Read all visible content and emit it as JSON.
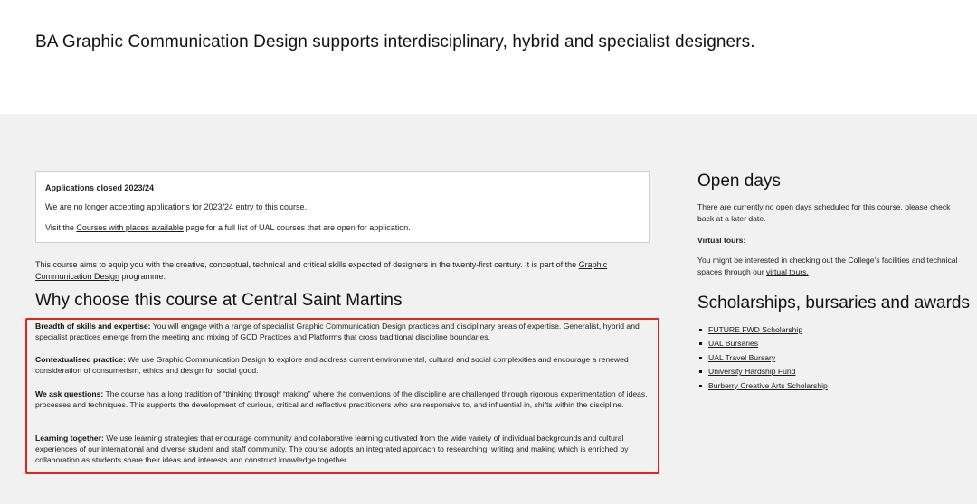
{
  "hero": {
    "title": "BA Graphic Communication Design supports interdisciplinary, hybrid and specialist designers."
  },
  "notice": {
    "title": "Applications closed 2023/24",
    "line1": "We are no longer accepting applications for 2023/24 entry to this course.",
    "line2_before": "Visit the ",
    "line2_link": "Courses with places available",
    "line2_after": " page for a full list of UAL courses that are open for application."
  },
  "intro": {
    "text": "This course aims to equip you with the creative, conceptual, technical and critical skills expected of designers in the twenty-first century. It is part of the ",
    "link": "Graphic Communication Design",
    "after": " programme."
  },
  "why": {
    "heading": "Why choose this course at Central Saint Martins",
    "reasons": [
      {
        "title": "Breadth of skills and expertise:",
        "text": " You will engage with a range of specialist Graphic Communication Design practices and disciplinary areas of expertise. Generalist, hybrid and specialist practices emerge from the meeting and mixing of GCD Practices and Platforms that cross traditional discipline boundaries."
      },
      {
        "title": "Contextualised practice:",
        "text": " We use Graphic Communication Design to explore and address current environmental, cultural and social complexities and encourage a renewed consideration of consumerism, ethics and design for social good."
      },
      {
        "title": "We ask questions:",
        "text": " The course has a long tradition of “thinking through making” where the conventions of the discipline are challenged through rigorous experimentation of ideas, processes and techniques. This supports the development of curious, critical and reflective practitioners who are responsive to, and influential in, shifts within the discipline."
      },
      {
        "title": "Learning together:",
        "text": " We use learning strategies that encourage community and collaborative learning cultivated from the wide variety of individual backgrounds and cultural experiences of our international and diverse student and staff community. The course adopts an integrated approach to researching, writing and making which is enriched by collaboration as students share their ideas and interests and construct knowledge together."
      }
    ]
  },
  "open_days": {
    "heading": "Open days",
    "text": "There are currently no open days scheduled for this course, please check back at a later date.",
    "virtual_title": "Virtual tours:",
    "virtual_text": "You might be interested in checking out the College's facilities and technical spaces through our ",
    "virtual_link": "virtual tours."
  },
  "scholarships": {
    "heading": "Scholarships, bursaries and awards",
    "items": [
      "FUTURE FWD Scholarship",
      "UAL Bursaries",
      "UAL Travel Bursary",
      "University Hardship Fund",
      "Burberry Creative Arts Scholarship"
    ]
  },
  "colors": {
    "highlight_border": "#e0241e",
    "section_background": "#f1f1f1"
  }
}
